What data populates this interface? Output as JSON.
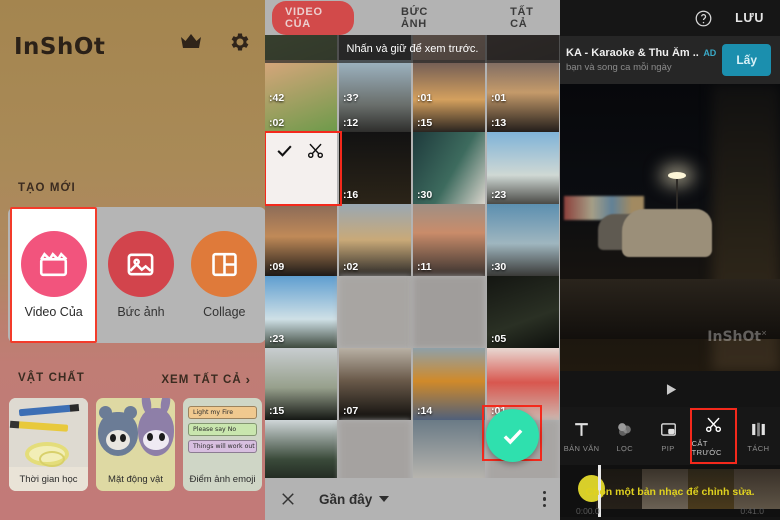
{
  "left": {
    "logo": "InShOt",
    "icons": {
      "crown": "crown-icon",
      "settings": "gear-icon"
    },
    "create_label": "TẠO MỚI",
    "create_items": [
      {
        "label": "Video Của",
        "icon": "clapperboard-icon",
        "color": "#f2547d",
        "selected": true
      },
      {
        "label": "Bức ảnh",
        "icon": "photo-icon",
        "color": "#d2444c",
        "selected": false
      },
      {
        "label": "Collage",
        "icon": "collage-icon",
        "color": "#df7a3a",
        "selected": false
      }
    ],
    "materials_label": "VẬT CHẤT",
    "see_all": "XEM TẤT CẢ",
    "see_all_chevron": "chevron-right-icon",
    "materials": [
      {
        "caption": "Thời gian học"
      },
      {
        "caption": "Mặt động vật"
      },
      {
        "caption": "Điểm ảnh emoji"
      }
    ],
    "emoji_cards": [
      "Light my Fire",
      "Please say No",
      "Things will work out"
    ]
  },
  "center": {
    "tabs": [
      {
        "label": "VIDEO CỦA",
        "active": true
      },
      {
        "label": "BỨC ẢNH",
        "active": false
      },
      {
        "label": "TẤT CẢ",
        "active": false
      }
    ],
    "tooltip": "Nhấn và giữ để xem trước.",
    "grid": [
      [
        {
          "dur": ":42",
          "type": "field"
        },
        {
          "dur": ":3?",
          "type": "dark"
        },
        {
          "dur": ":01",
          "type": "hands"
        },
        {
          "dur": ":01",
          "type": "dark2"
        }
      ],
      [
        {
          "dur": ":02",
          "type": "food"
        },
        {
          "dur": ":12",
          "type": "street"
        },
        {
          "dur": ":15",
          "type": "sunset"
        },
        {
          "dur": ":13",
          "type": "dusk"
        }
      ],
      [
        {
          "dur": "",
          "type": "selected",
          "selected": true
        },
        {
          "dur": ":16",
          "type": "night"
        },
        {
          "dur": ":30",
          "type": "bus"
        },
        {
          "dur": ":23",
          "type": "road"
        }
      ],
      [
        {
          "dur": ":09",
          "type": "sunset2"
        },
        {
          "dur": ":02",
          "type": "cloud"
        },
        {
          "dur": ":11",
          "type": "crowd"
        },
        {
          "dur": ":30",
          "type": "boats"
        }
      ],
      [
        {
          "dur": ":23",
          "type": "sky"
        },
        {
          "dur": "",
          "type": "blurgray"
        },
        {
          "dur": "",
          "type": "blurgray"
        },
        {
          "dur": ":05",
          "type": "darkgreen"
        }
      ],
      [
        {
          "dur": ":15",
          "type": "tower"
        },
        {
          "dur": ":07",
          "type": "treeline"
        },
        {
          "dur": ":14",
          "type": "drink"
        },
        {
          "dur": ":01",
          "type": "portrait",
          "fabSelected": true
        }
      ],
      [
        {
          "dur": "",
          "type": "forest"
        },
        {
          "dur": "",
          "type": "blurgray"
        },
        {
          "dur": "",
          "type": "tiles"
        },
        {
          "dur": "",
          "type": "blurgray"
        }
      ]
    ],
    "fab_icon": "check-icon",
    "bottom": {
      "close_icon": "close-icon",
      "folder_label": "Gần đây",
      "caret_icon": "caret-down-icon",
      "menu_icon": "more-vertical-icon"
    }
  },
  "right": {
    "header": {
      "help_icon": "help-circle-icon",
      "save_label": "LƯU"
    },
    "ad": {
      "title": "KA - Karaoke & Thu Âm ...",
      "subtitle": "bạn và song ca mỗi ngày",
      "badge": "AD",
      "cta": "Lấy"
    },
    "preview": {
      "watermark": "InShOt",
      "play_icon": "play-icon"
    },
    "tools": [
      {
        "label": "BẢN VĂN",
        "icon": "text-icon",
        "highlight": false
      },
      {
        "label": "LỌC",
        "icon": "filter-icon",
        "highlight": false
      },
      {
        "label": "PIP",
        "icon": "pip-icon",
        "highlight": false
      },
      {
        "label": "CẮT TRƯỚC",
        "icon": "scissors-icon",
        "highlight": true
      },
      {
        "label": "TÁCH",
        "icon": "split-icon",
        "highlight": false
      }
    ],
    "music_hint": "Chọn một bản nhạc để chỉnh sửa.",
    "time_start": "0:00.0",
    "time_end": "0:41.0"
  }
}
